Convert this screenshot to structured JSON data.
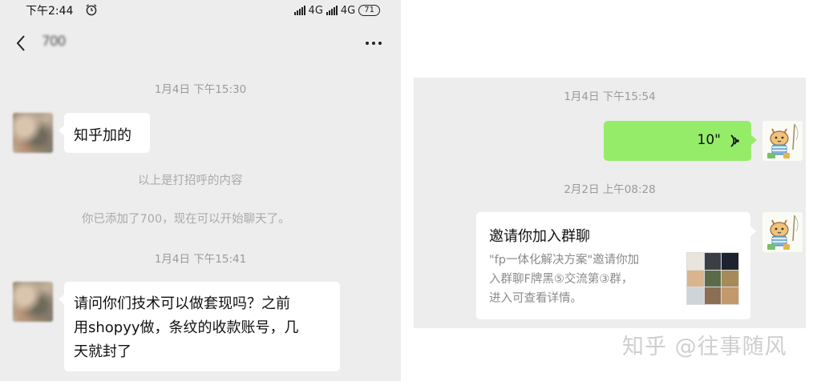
{
  "left": {
    "status": {
      "time": "下午2:44",
      "network": "4G",
      "network2": "4G",
      "battery": "71"
    },
    "contact_name": "700",
    "messages": [
      {
        "type": "time",
        "text": "1月4日 下午15:30"
      },
      {
        "type": "incoming",
        "text": "知乎加的"
      },
      {
        "type": "system",
        "text": "以上是打招呼的内容"
      },
      {
        "type": "system",
        "text": "你已添加了700，现在可以开始聊天了。"
      },
      {
        "type": "time",
        "text": "1月4日 下午15:41"
      },
      {
        "type": "incoming",
        "lines": [
          "请问你们技术可以做套现吗？之前",
          "用shopyy做，条纹的收款账号，几",
          "天就封了"
        ]
      }
    ]
  },
  "right": {
    "messages": [
      {
        "type": "time",
        "text": "1月4日 下午15:54"
      },
      {
        "type": "voice",
        "duration": "10\""
      },
      {
        "type": "time",
        "text": "2月2日 上午08:28"
      },
      {
        "type": "group_invite",
        "title": "邀请你加入群聊",
        "lines": [
          "\"fp一体化解决方案\"邀请你加",
          "入群聊F牌黑⑤交流第③群，",
          "进入可查看详情。"
        ]
      }
    ]
  },
  "watermark": "知乎 @往事随风",
  "colors": {
    "chat_bg": "#ededed",
    "self_bubble": "#95ec69",
    "other_bubble": "#ffffff",
    "muted_text": "#9a9a9a"
  },
  "icons": [
    "back-arrow-icon",
    "more-icon",
    "alarm-clock-icon",
    "signal-icon",
    "battery-icon",
    "voice-wave-icon"
  ]
}
